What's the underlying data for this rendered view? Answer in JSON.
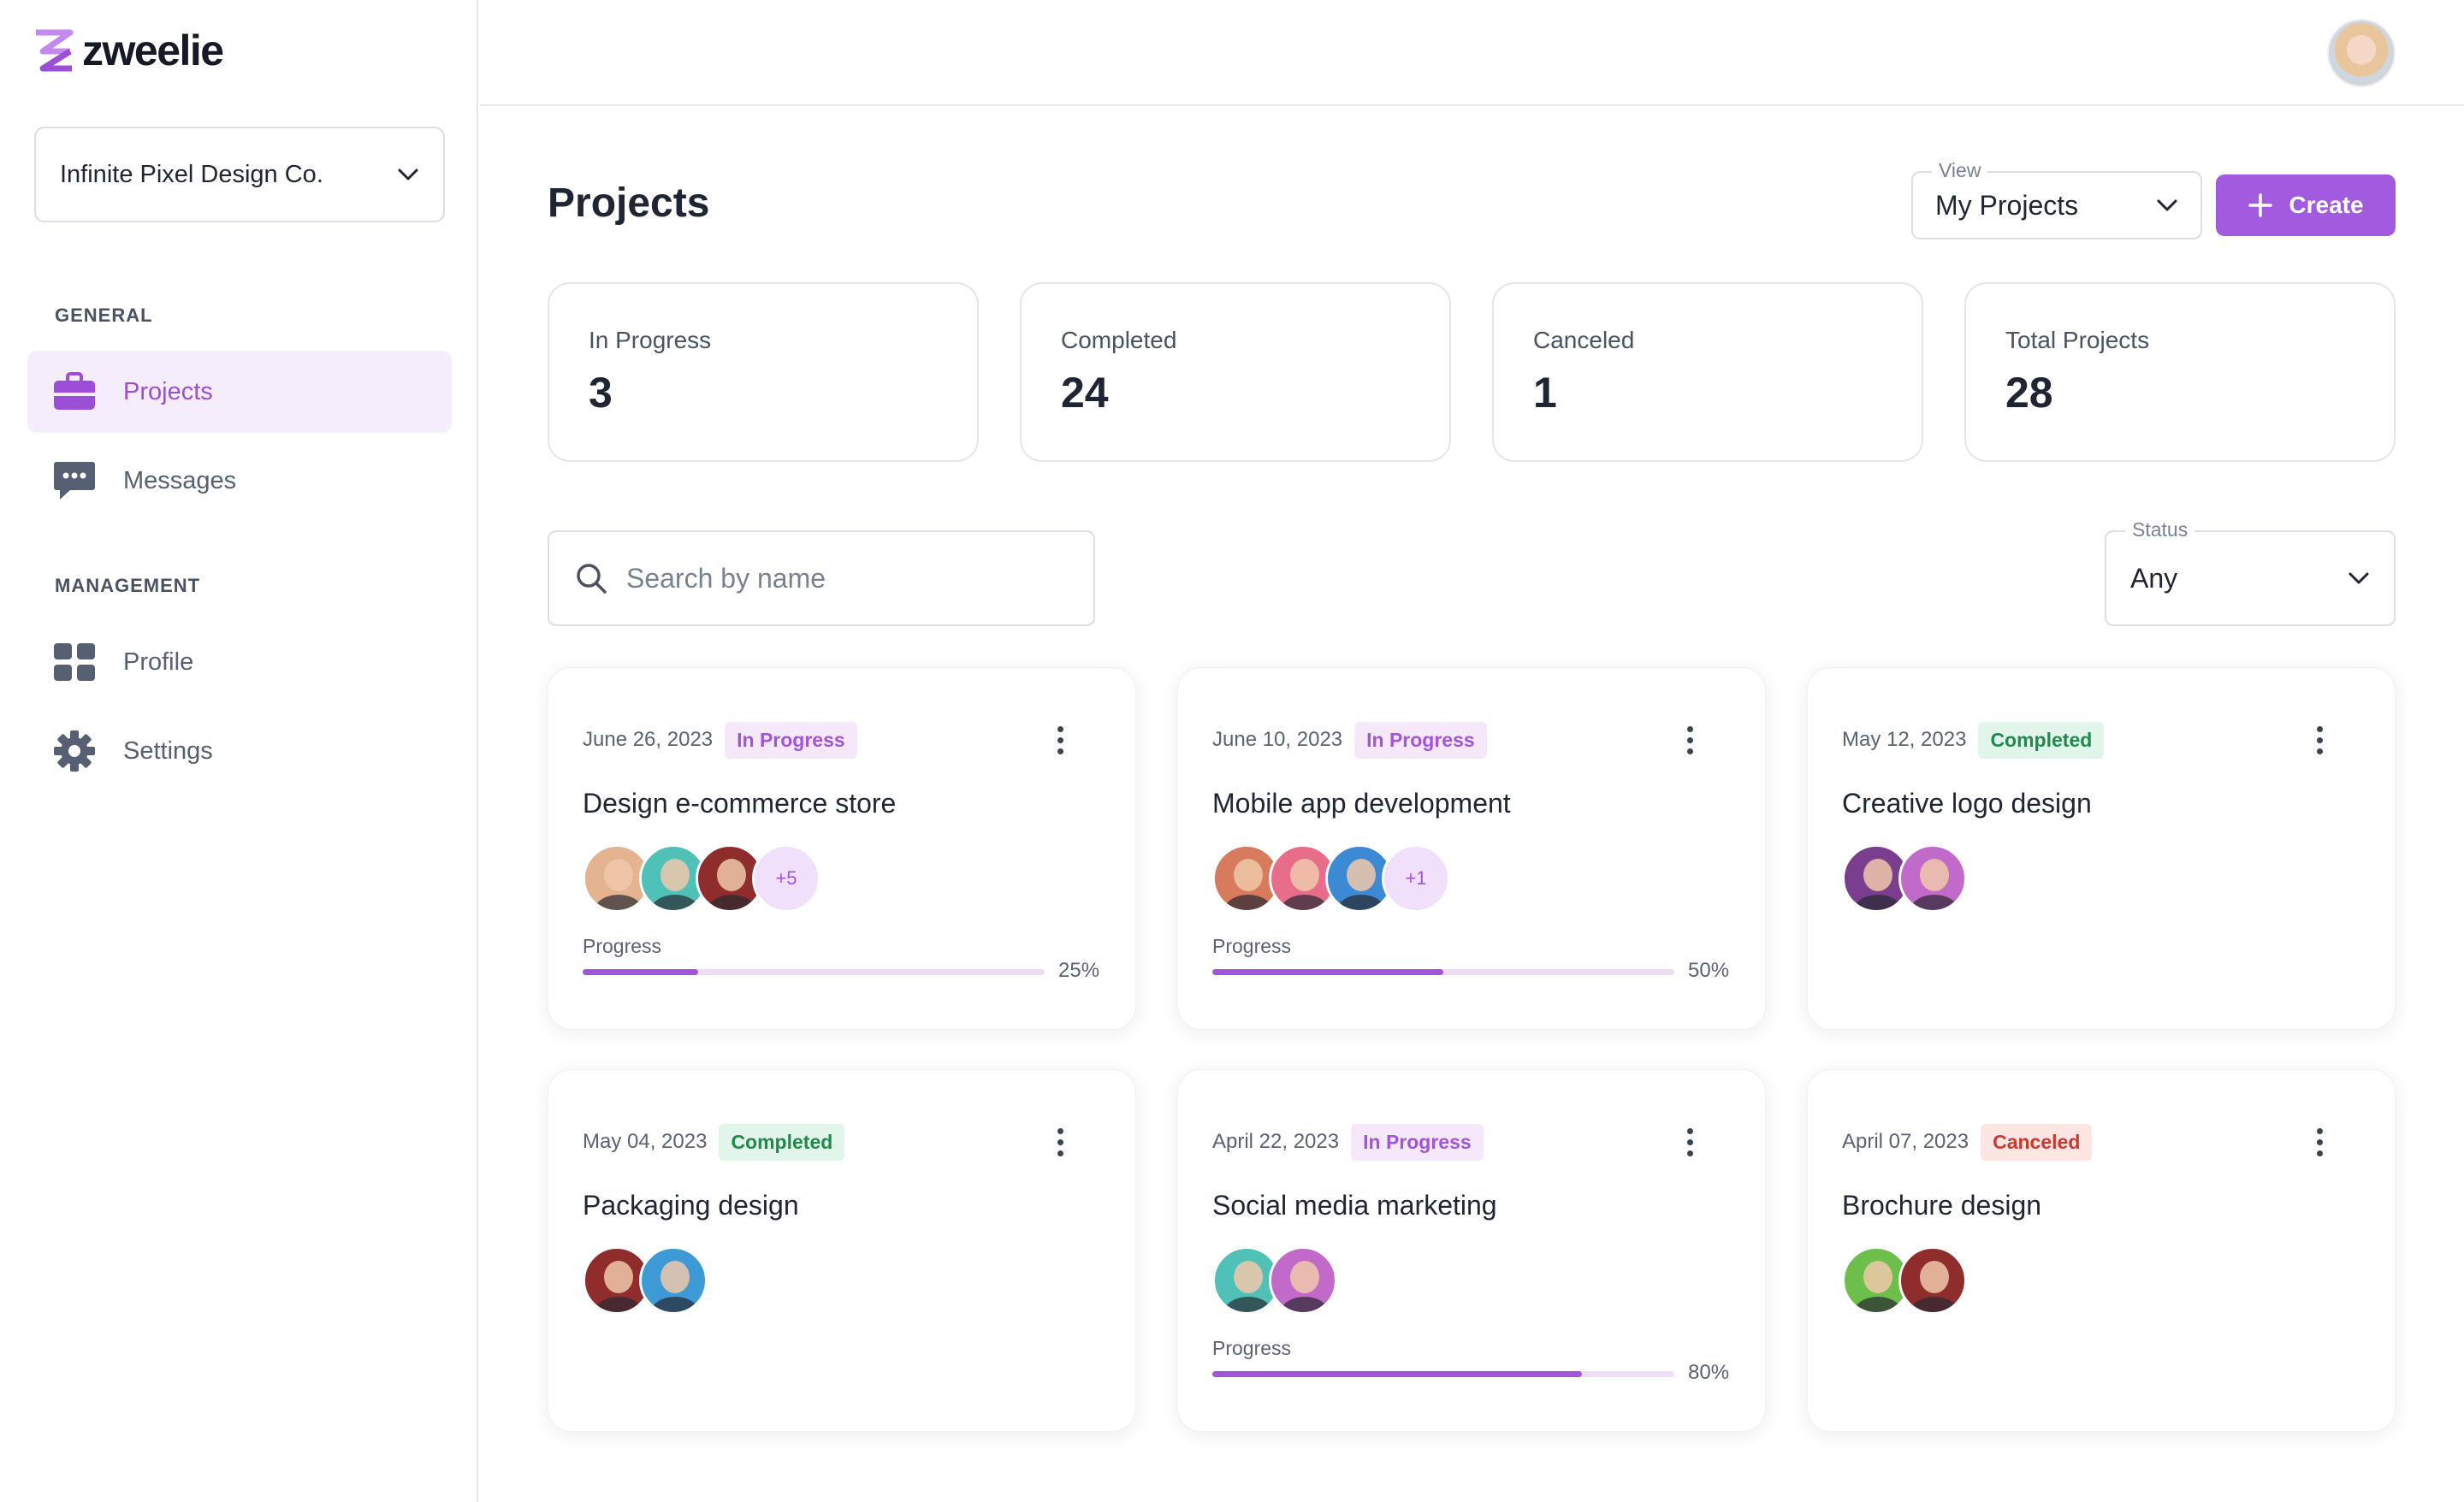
{
  "app": {
    "name": "zweelie"
  },
  "org_select": {
    "value": "Infinite Pixel Design Co."
  },
  "sidebar": {
    "general_label": "GENERAL",
    "management_label": "MANAGEMENT",
    "items": [
      {
        "label": "Projects",
        "icon": "briefcase-icon",
        "active": true
      },
      {
        "label": "Messages",
        "icon": "chat-icon",
        "active": false
      },
      {
        "label": "Profile",
        "icon": "grid-icon",
        "active": false
      },
      {
        "label": "Settings",
        "icon": "gear-icon",
        "active": false
      }
    ]
  },
  "header": {
    "title": "Projects"
  },
  "view_select": {
    "label": "View",
    "value": "My Projects"
  },
  "create_button": {
    "label": "Create"
  },
  "stats": [
    {
      "label": "In Progress",
      "value": "3"
    },
    {
      "label": "Completed",
      "value": "24"
    },
    {
      "label": "Canceled",
      "value": "1"
    },
    {
      "label": "Total Projects",
      "value": "28"
    }
  ],
  "search": {
    "placeholder": "Search by name"
  },
  "status_filter": {
    "label": "Status",
    "value": "Any"
  },
  "projects": [
    {
      "date": "June 26, 2023",
      "status": "In Progress",
      "title": "Design e-commerce store",
      "more": "+5",
      "progress_label": "Progress",
      "progress": 25,
      "progress_text": "25%"
    },
    {
      "date": "June 10, 2023",
      "status": "In Progress",
      "title": "Mobile app development",
      "more": "+1",
      "progress_label": "Progress",
      "progress": 50,
      "progress_text": "50%"
    },
    {
      "date": "May 12, 2023",
      "status": "Completed",
      "title": "Creative logo design"
    },
    {
      "date": "May 04, 2023",
      "status": "Completed",
      "title": "Packaging design"
    },
    {
      "date": "April 22, 2023",
      "status": "In Progress",
      "title": "Social media marketing",
      "progress_label": "Progress",
      "progress": 80,
      "progress_text": "80%"
    },
    {
      "date": "April 07, 2023",
      "status": "Canceled",
      "title": "Brochure design"
    }
  ],
  "colors": {
    "accent": "#a25bdf",
    "completed": "#1f8a4c",
    "canceled": "#c83a2e"
  }
}
